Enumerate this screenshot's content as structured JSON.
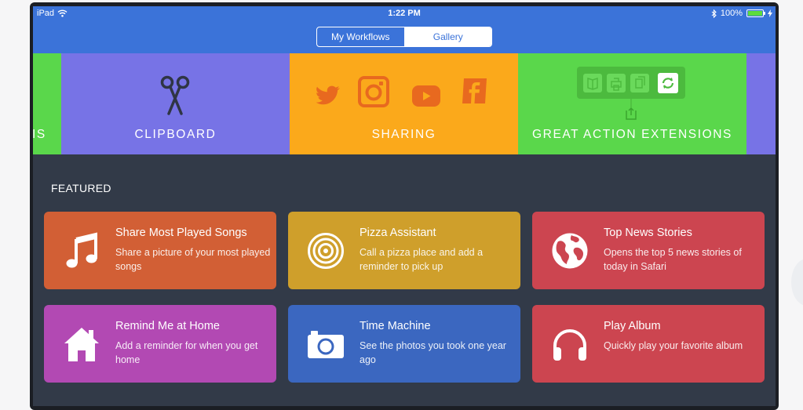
{
  "status": {
    "device": "iPad",
    "time": "1:22 PM",
    "battery_text": "100%",
    "battery_level": 1.0
  },
  "nav": {
    "tab_workflows": "My Workflows",
    "tab_gallery": "Gallery",
    "selected": "Gallery"
  },
  "carousel": {
    "partial_left_label": "IS",
    "tiles": [
      {
        "label": "CLIPBOARD",
        "color": "#7773e6",
        "icon": "scissors-icon"
      },
      {
        "label": "SHARING",
        "color": "#fba91b",
        "icons": [
          "twitter-icon",
          "instagram-icon",
          "youtube-icon",
          "facebook-icon"
        ]
      },
      {
        "label": "GREAT ACTION EXTENSIONS",
        "color": "#5ad74b",
        "icons": [
          "book-icon",
          "print-icon",
          "copy-icon",
          "sync-icon",
          "share-icon"
        ]
      }
    ]
  },
  "featured": {
    "heading": "FEATURED",
    "cards": [
      {
        "title": "Share Most Played Songs",
        "desc": "Share a picture of your most played songs",
        "color": "#d25f35",
        "icon": "music-note-icon"
      },
      {
        "title": "Pizza Assistant",
        "desc": "Call a pizza place and add a reminder to pick up",
        "color": "#cf9f2b",
        "icon": "target-icon"
      },
      {
        "title": "Top News Stories",
        "desc": "Opens the top 5 news stories of today in Safari",
        "color": "#cc4550",
        "icon": "globe-icon"
      },
      {
        "title": "Remind Me at Home",
        "desc": "Add a reminder for when you get home",
        "color": "#b249b3",
        "icon": "house-icon"
      },
      {
        "title": "Time Machine",
        "desc": "See the photos you took one year ago",
        "color": "#3b67c0",
        "icon": "camera-icon"
      },
      {
        "title": "Play Album",
        "desc": "Quickly play your favorite album",
        "color": "#cc4550",
        "icon": "headphones-icon"
      }
    ]
  }
}
